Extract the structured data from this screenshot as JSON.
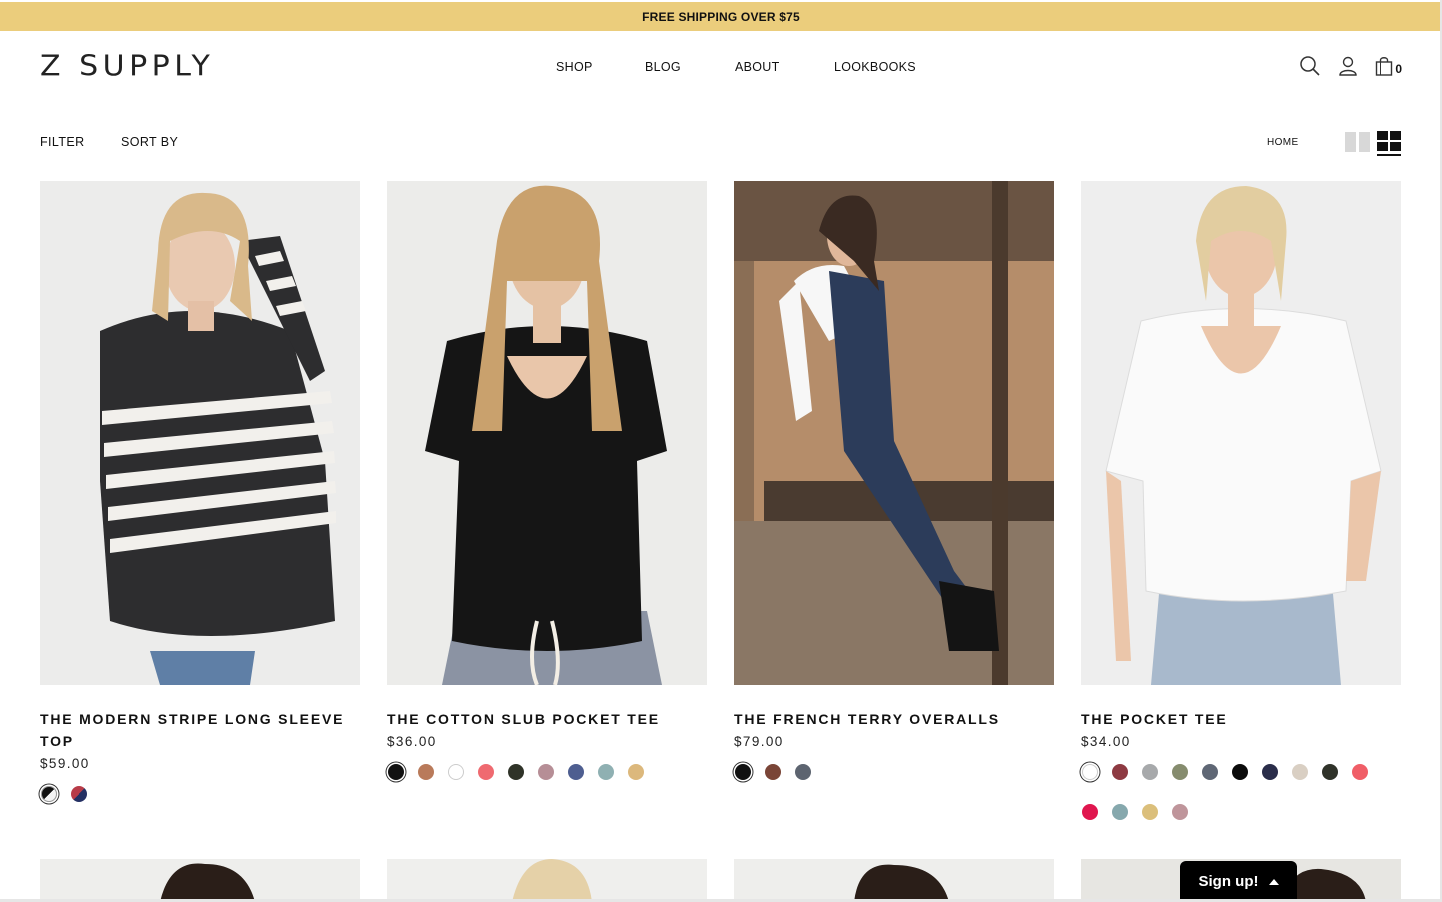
{
  "promo": {
    "text": "FREE SHIPPING OVER $75"
  },
  "header": {
    "logo": "Z SUPPLY",
    "nav": [
      "SHOP",
      "BLOG",
      "ABOUT",
      "LOOKBOOKS"
    ],
    "cart_count": "0"
  },
  "toolbar": {
    "filter": "FILTER",
    "sort": "SORT BY",
    "breadcrumb": "HOME"
  },
  "products": [
    {
      "title": "THE MODERN STRIPE LONG SLEEVE TOP",
      "price": "$59.00",
      "swatches": [
        "black-white-stripe",
        "navy-red"
      ]
    },
    {
      "title": "THE COTTON SLUB POCKET TEE",
      "price": "$36.00",
      "swatches": [
        "#111111",
        "#b97a5a",
        "#ffffff",
        "#ef6a70",
        "#2f3328",
        "#b68e96",
        "#4e5e90",
        "#8fb0b2",
        "#dcb87c"
      ]
    },
    {
      "title": "THE FRENCH TERRY OVERALLS",
      "price": "$79.00",
      "swatches": [
        "#111111",
        "#7a4537",
        "#5d6470"
      ]
    },
    {
      "title": "THE POCKET TEE",
      "price": "$34.00",
      "swatches": [
        "#ffffff",
        "#8e3a42",
        "#a7a9ab",
        "#868c6e",
        "#5f6775",
        "#0b0b0b",
        "#2a2d4a",
        "#d9cfc3",
        "#30332a",
        "#f05e67",
        "#e0164e",
        "#86a8ad",
        "#dbbf7b",
        "#bf959b"
      ]
    }
  ],
  "signup": {
    "label": "Sign up!"
  }
}
